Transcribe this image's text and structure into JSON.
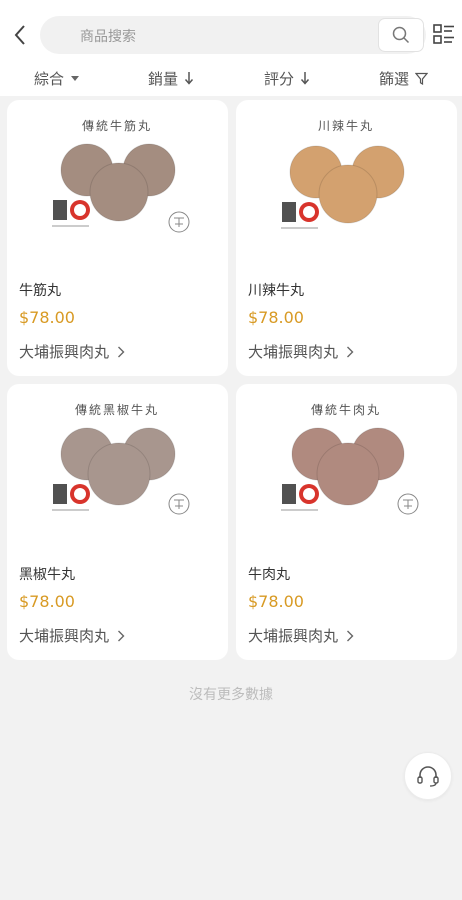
{
  "search": {
    "placeholder": "商品搜索"
  },
  "sort": {
    "items": [
      {
        "label": "綜合",
        "icon": "caret-down-icon"
      },
      {
        "label": "銷量",
        "icon": "arrow-down-icon"
      },
      {
        "label": "評分",
        "icon": "arrow-down-icon"
      },
      {
        "label": "篩選",
        "icon": "filter-icon"
      }
    ]
  },
  "products": [
    {
      "image_title": "傳統牛筋丸",
      "name": "牛筋丸",
      "price": "$78.00",
      "shop": "大埔振興肉丸",
      "ball_color": "#a48d80"
    },
    {
      "image_title": "川辣牛丸",
      "name": "川辣牛丸",
      "price": "$78.00",
      "shop": "大埔振興肉丸",
      "ball_color": "#d3a16f"
    },
    {
      "image_title": "傳統黑椒牛丸",
      "name": "黑椒牛丸",
      "price": "$78.00",
      "shop": "大埔振興肉丸",
      "ball_color": "#a8968e"
    },
    {
      "image_title": "傳統牛肉丸",
      "name": "牛肉丸",
      "price": "$78.00",
      "shop": "大埔振興肉丸",
      "ball_color": "#b08a7f"
    }
  ],
  "footer": {
    "no_more": "沒有更多數據"
  },
  "colors": {
    "price": "#d89a24",
    "background": "#f2f2f2"
  },
  "icons": {
    "back": "chevron-left-icon",
    "search": "search-icon",
    "layout": "list-layout-icon",
    "support": "headset-icon"
  }
}
